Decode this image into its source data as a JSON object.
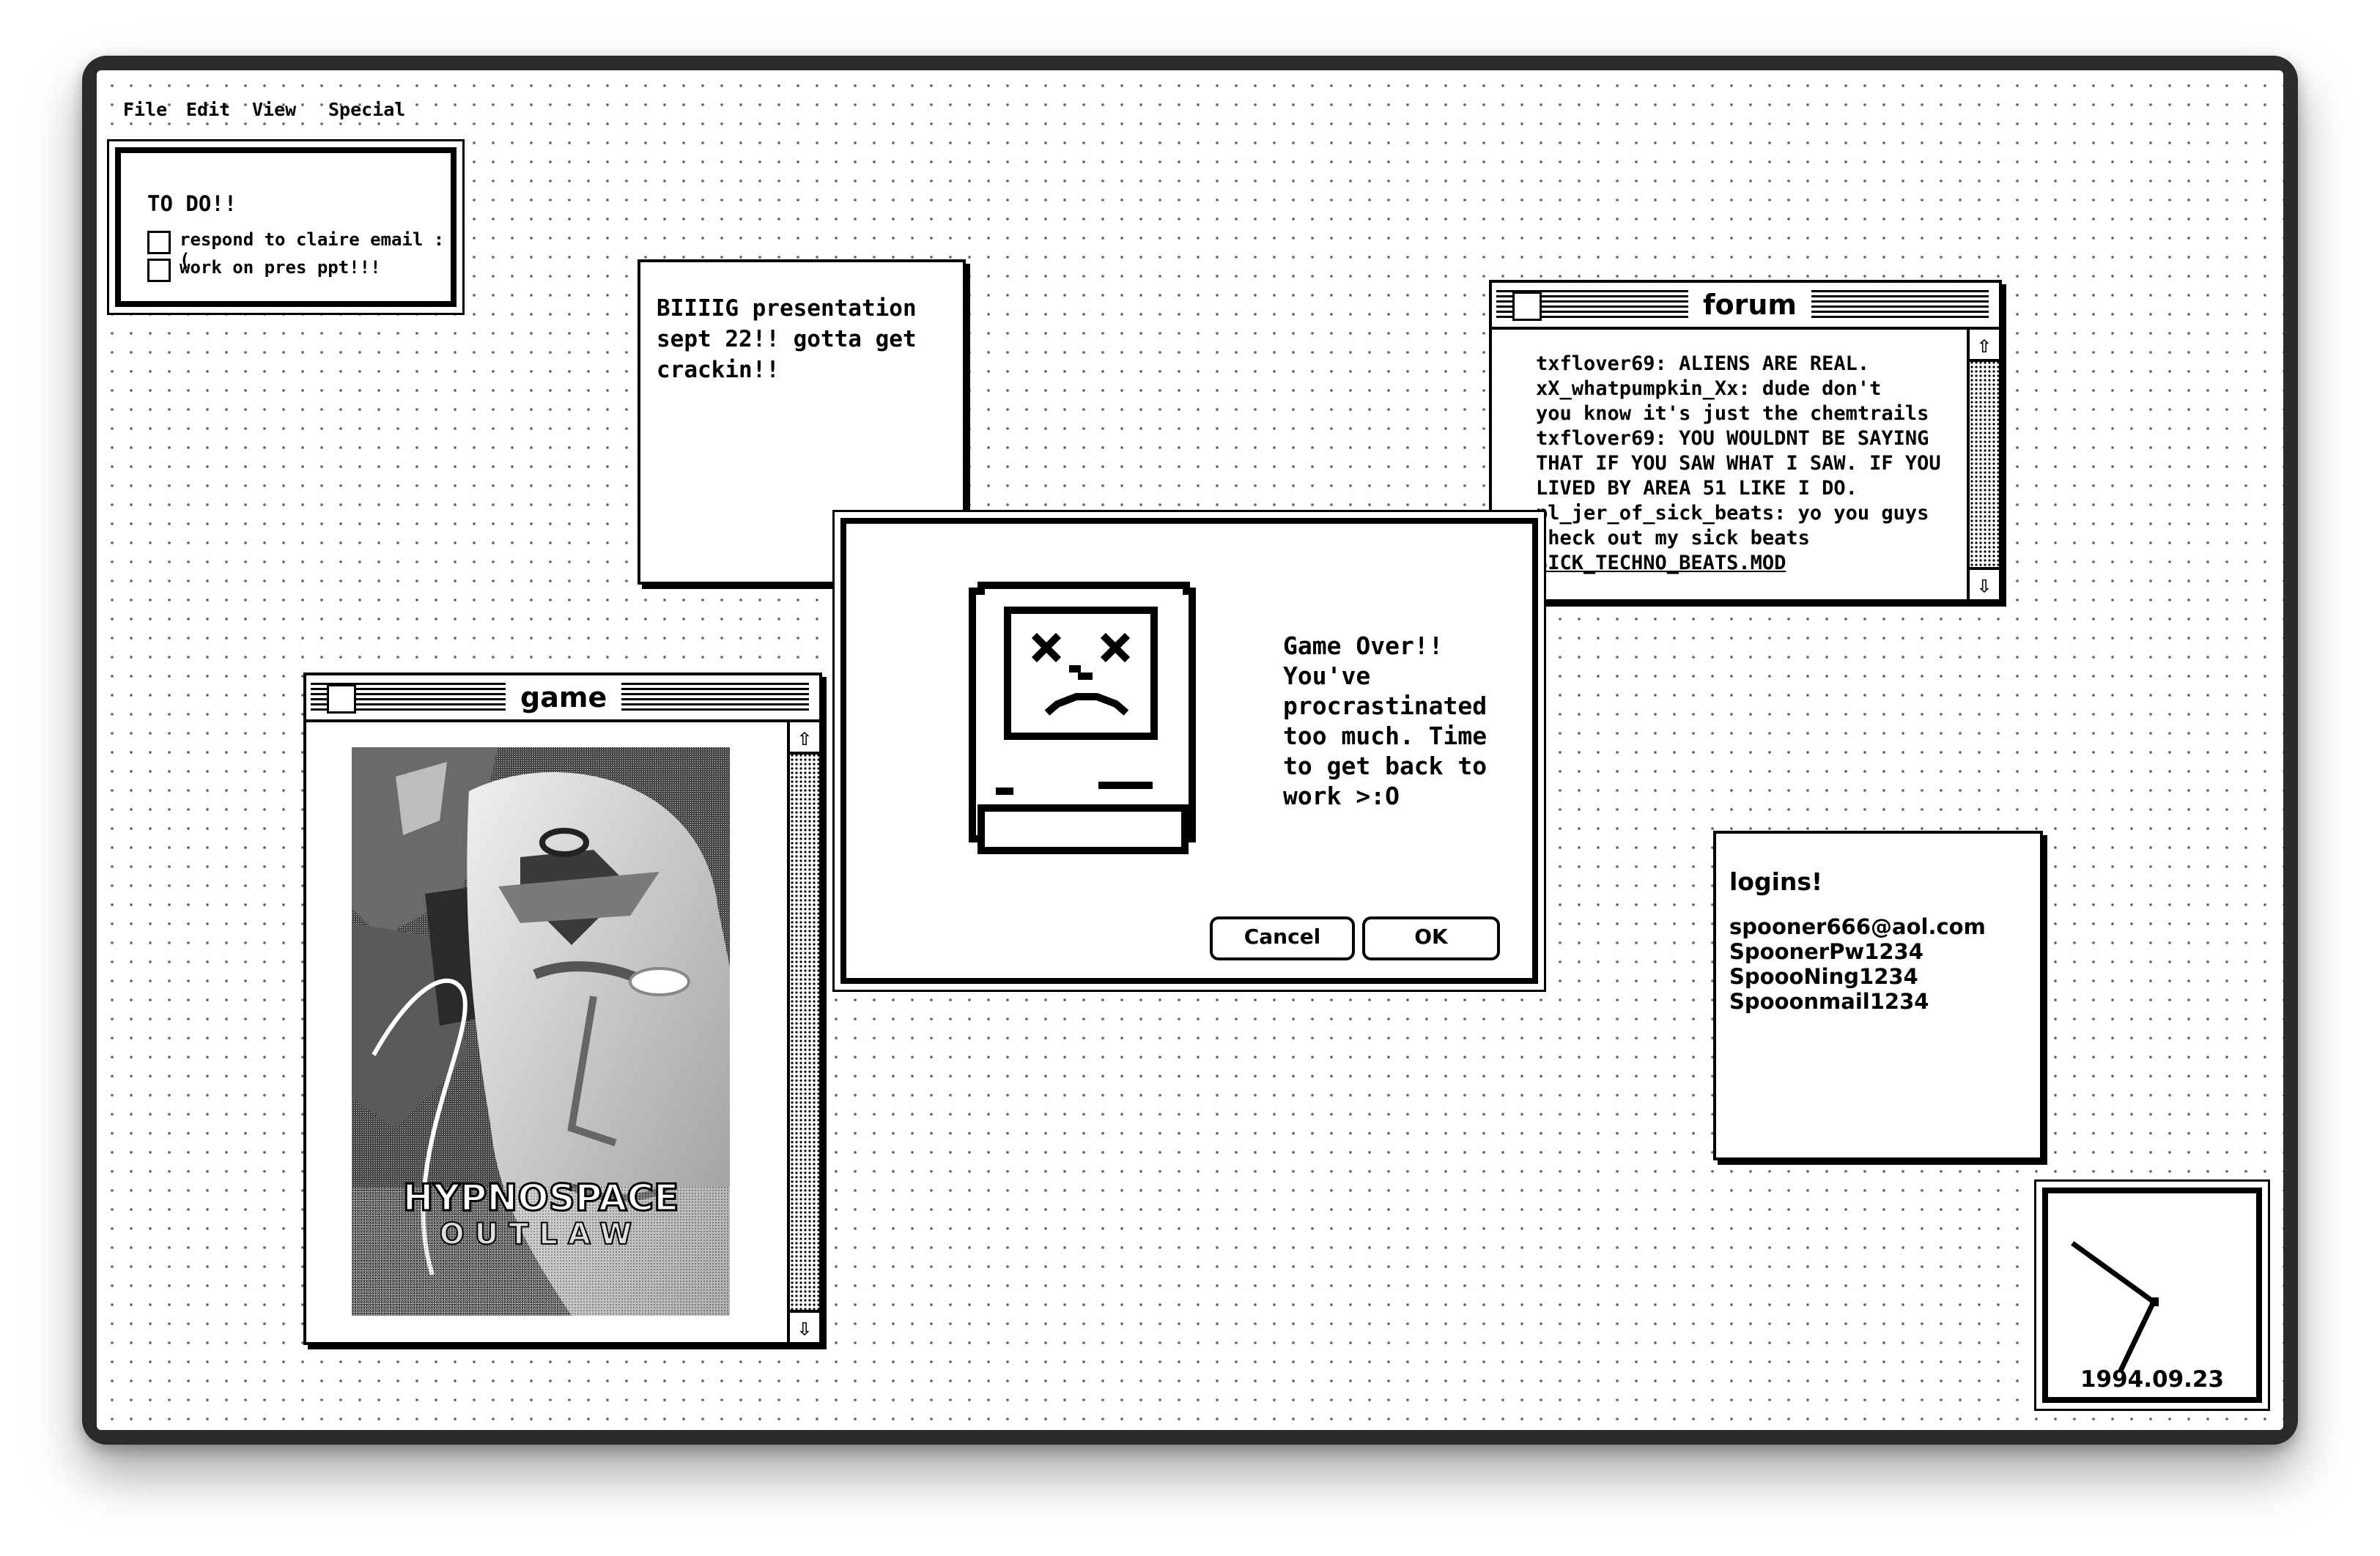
{
  "menu": {
    "items": [
      "File",
      "Edit",
      "View",
      "Special"
    ]
  },
  "todo": {
    "title": "TO DO!!",
    "items": [
      "respond to claire email :(",
      "work on pres ppt!!!"
    ]
  },
  "note": {
    "lines": [
      "BIIIIG presentation",
      "sept 22!! gotta get",
      "crackin!!"
    ]
  },
  "forum": {
    "title": "forum",
    "lines": [
      "txflover69: ALIENS ARE REAL.",
      "xX_whatpumpkin_Xx: dude don't",
      "you know it's just the chemtrails",
      "txflover69: YOU WOULDNT BE SAYING",
      "THAT IF YOU SAW WHAT I SAW. IF YOU",
      "LIVED BY AREA 51 LIKE I DO.",
      "pl_jer_of_sick_beats: yo you guys",
      "check out my sick beats",
      "SICK_TECHNO_BEATS.MOD"
    ]
  },
  "game": {
    "title": "game",
    "image_alt": "HYPNOSPACE OUTLAW",
    "logo_line1": "HYPNOSPACE",
    "logo_line2": "OUTLAW"
  },
  "dialog": {
    "message_lines": [
      "Game Over!!",
      "You've",
      "procrastinated",
      "too much. Time",
      "to get back to",
      "work >:O"
    ],
    "cancel_label": "Cancel",
    "ok_label": "OK"
  },
  "logins": {
    "title": "logins!",
    "lines": [
      "spooner666@aol.com",
      "SpoonerPw1234",
      "SpoooNing1234",
      "Spooonmail1234"
    ]
  },
  "clock": {
    "date": "1994.09.23"
  }
}
